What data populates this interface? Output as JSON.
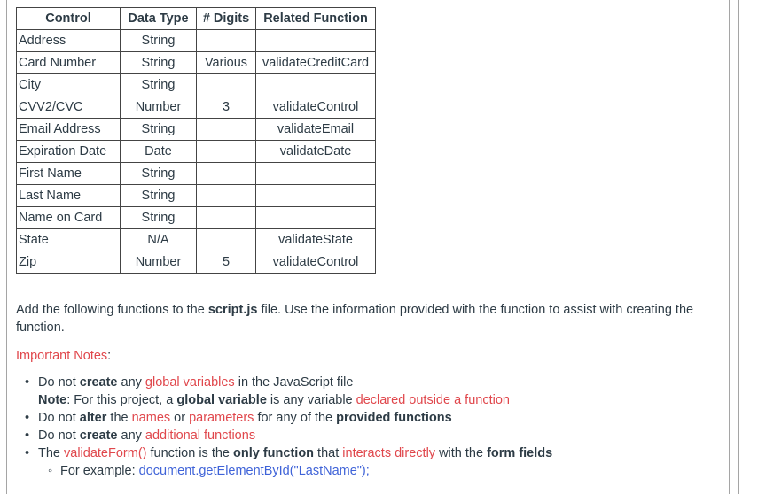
{
  "table": {
    "headers": [
      "Control",
      "Data Type",
      "# Digits",
      "Related Function"
    ],
    "rows": [
      [
        "Address",
        "String",
        "",
        ""
      ],
      [
        "Card Number",
        "String",
        "Various",
        "validateCreditCard"
      ],
      [
        "City",
        "String",
        "",
        ""
      ],
      [
        "CVV2/CVC",
        "Number",
        "3",
        "validateControl"
      ],
      [
        "Email Address",
        "String",
        "",
        "validateEmail"
      ],
      [
        "Expiration Date",
        "Date",
        "",
        "validateDate"
      ],
      [
        "First Name",
        "String",
        "",
        ""
      ],
      [
        "Last Name",
        "String",
        "",
        ""
      ],
      [
        "Name on Card",
        "String",
        "",
        ""
      ],
      [
        "State",
        "N/A",
        "",
        "validateState"
      ],
      [
        "Zip",
        "Number",
        "5",
        "validateControl"
      ]
    ]
  },
  "intro": {
    "part1": "Add the following functions to the ",
    "file": "script.js",
    "part2": " file. Use the information provided with the function to assist with creating the function."
  },
  "notes_heading": {
    "label": "Important Notes",
    "suffix": ":"
  },
  "notes": {
    "n1": {
      "a": "Do not ",
      "b_create": "create",
      "c": " any ",
      "r_global": "global variables",
      "d": " in the JavaScript file",
      "note_label": "Note",
      "e": ": For this project, a ",
      "b_gv": "global variable",
      "f": " is any variable ",
      "r_declared": "declared outside a function"
    },
    "n2": {
      "a": "Do not ",
      "b_alter": "alter",
      "c": " the ",
      "r_names": "names",
      "d": " or ",
      "r_params": "parameters",
      "e": " for any of the ",
      "b_provided": "provided functions"
    },
    "n3": {
      "a": "Do not ",
      "b_create": "create",
      "c": " any ",
      "r_additional": "additional functions"
    },
    "n4": {
      "a": "The ",
      "r_validate": "validateForm()",
      "b": " function is the ",
      "b_only": "only function",
      "c": " that ",
      "r_interacts": "interacts directly",
      "d": " with the ",
      "b_fields": "form fields",
      "sub_label": "For example: ",
      "sub_code": "document.getElementById(\"LastName\");"
    }
  },
  "colors": {
    "accent_red": "#e0474c",
    "link_blue": "#3f63d8",
    "text": "#2d3b45"
  }
}
